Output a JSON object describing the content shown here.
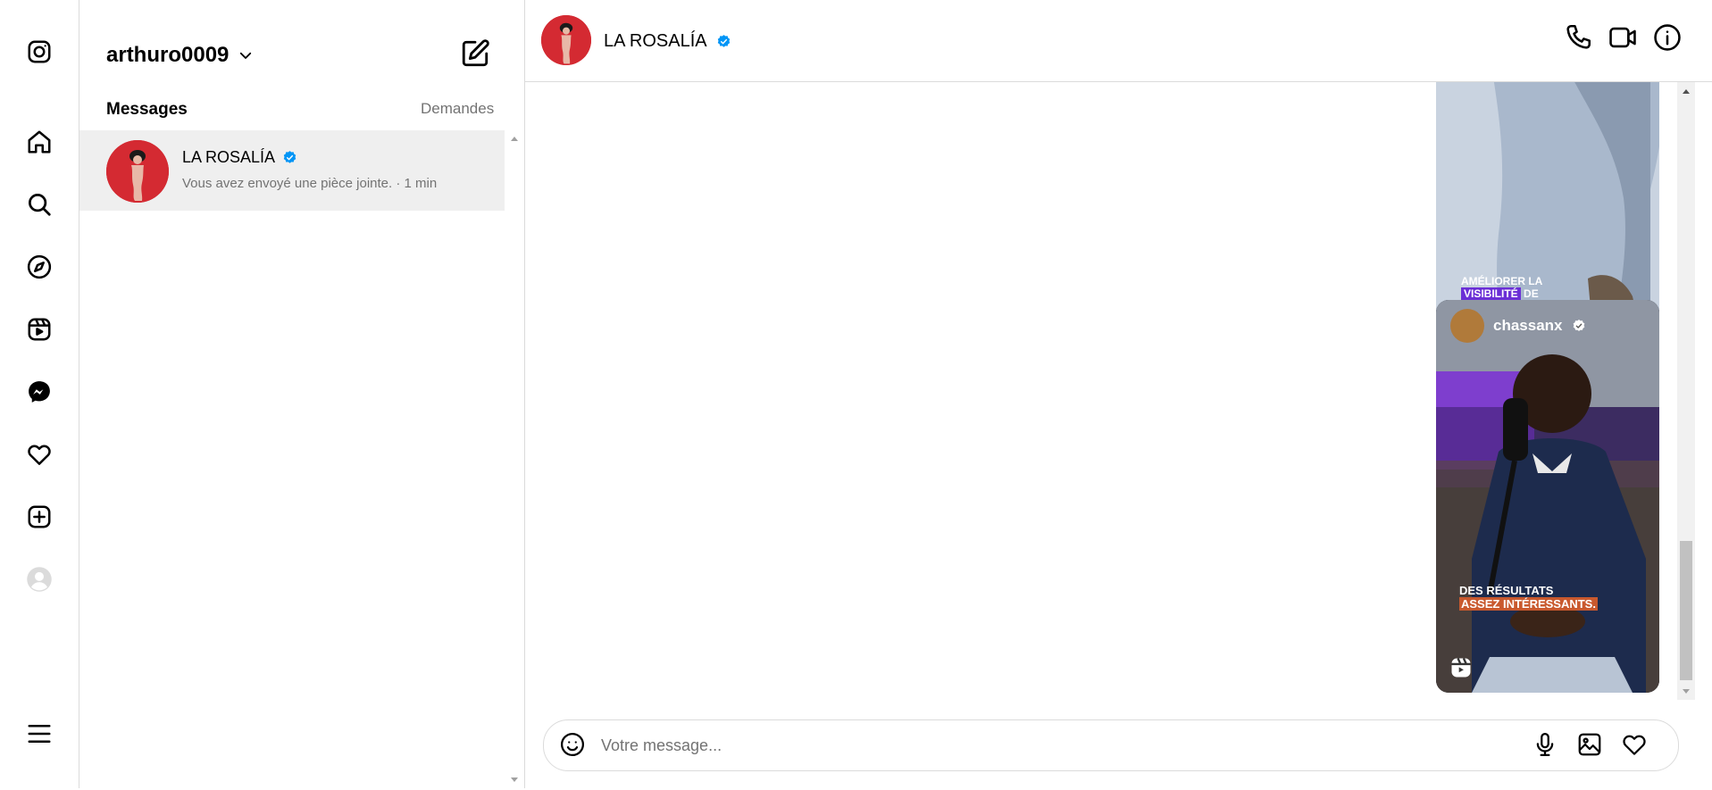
{
  "account": {
    "username": "arthuro0009"
  },
  "list": {
    "heading": "Messages",
    "requests_label": "Demandes",
    "threads": [
      {
        "name": "LA ROSALÍA",
        "verified": true,
        "preview": "Vous avez envoyé une pièce jointe. · 1 min"
      }
    ]
  },
  "chat": {
    "name": "LA ROSALÍA",
    "verified": true,
    "reels": [
      {
        "overlay_line1": "AMÉLIORER LA",
        "overlay_line2_highlight": "VISIBILITÉ",
        "overlay_line2_rest": "DE"
      },
      {
        "author": "chassanx",
        "verified": true,
        "overlay_line1": "DES RÉSULTATS",
        "overlay_line2": "ASSEZ INTÉRESSANTS."
      }
    ]
  },
  "composer": {
    "placeholder": "Votre message..."
  },
  "icons": {
    "nav": [
      "instagram-icon",
      "home-icon",
      "search-icon",
      "explore-icon",
      "reels-icon",
      "messenger-icon",
      "heart-icon",
      "create-icon",
      "profile-icon",
      "menu-icon"
    ],
    "header": [
      "phone-icon",
      "video-icon",
      "info-icon"
    ],
    "composer": [
      "emoji-icon",
      "microphone-icon",
      "image-icon",
      "heart-icon"
    ]
  },
  "colors": {
    "verified": "#0095f6",
    "text_secondary": "#737373",
    "selected_row": "#efefef",
    "border": "#dbdbdb",
    "avatar_bg": "#d42a32"
  }
}
